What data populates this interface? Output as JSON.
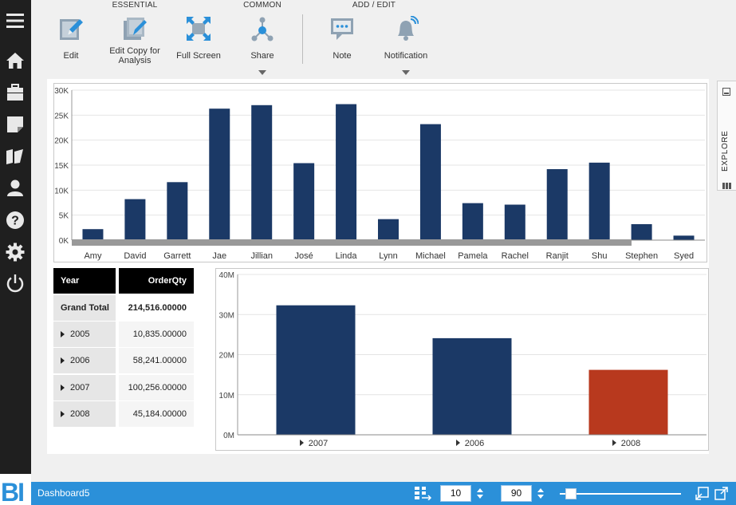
{
  "toolbar": {
    "groups": [
      "ESSENTIAL",
      "COMMON",
      "ADD / EDIT"
    ],
    "buttons": {
      "edit": "Edit",
      "edit_copy": "Edit Copy for Analysis",
      "full_screen": "Full Screen",
      "share": "Share",
      "note": "Note",
      "notification": "Notification"
    }
  },
  "explore_tab": "EXPLORE",
  "colors": {
    "bar": "#1b3966",
    "highlight": "#b8391e",
    "sidebar": "#1f1f1f",
    "statusbar": "#2b90d9"
  },
  "chart_data": [
    {
      "type": "bar",
      "categories": [
        "Amy",
        "David",
        "Garrett",
        "Jae",
        "Jillian",
        "José",
        "Linda",
        "Lynn",
        "Michael",
        "Pamela",
        "Rachel",
        "Ranjit",
        "Shu",
        "Stephen",
        "Syed"
      ],
      "values": [
        2200,
        8200,
        11600,
        26300,
        27000,
        15400,
        27200,
        4200,
        23200,
        7400,
        7100,
        14200,
        15500,
        3200,
        900
      ],
      "yticks": [
        "30K",
        "25K",
        "20K",
        "15K",
        "10K",
        "5K",
        "0K"
      ],
      "ylim": [
        0,
        30000
      ]
    },
    {
      "type": "bar",
      "categories": [
        "2007",
        "2006",
        "2008"
      ],
      "values": [
        32300000,
        24100000,
        16200000
      ],
      "yticks": [
        "40M",
        "30M",
        "20M",
        "10M",
        "0M"
      ],
      "ylim": [
        0,
        40000000
      ]
    }
  ],
  "pivot": {
    "headers": [
      "Year",
      "OrderQty"
    ],
    "grand_total_label": "Grand Total",
    "grand_total_value": "214,516.00000",
    "rows": [
      {
        "year": "2005",
        "value": "10,835.00000"
      },
      {
        "year": "2006",
        "value": "58,241.00000"
      },
      {
        "year": "2007",
        "value": "100,256.00000"
      },
      {
        "year": "2008",
        "value": "45,184.00000"
      }
    ]
  },
  "statusbar": {
    "logo_text": "BI",
    "dashboard_name": "Dashboard5",
    "grid_value": "10",
    "zoom_value": "90",
    "slider_level": 0.05
  }
}
